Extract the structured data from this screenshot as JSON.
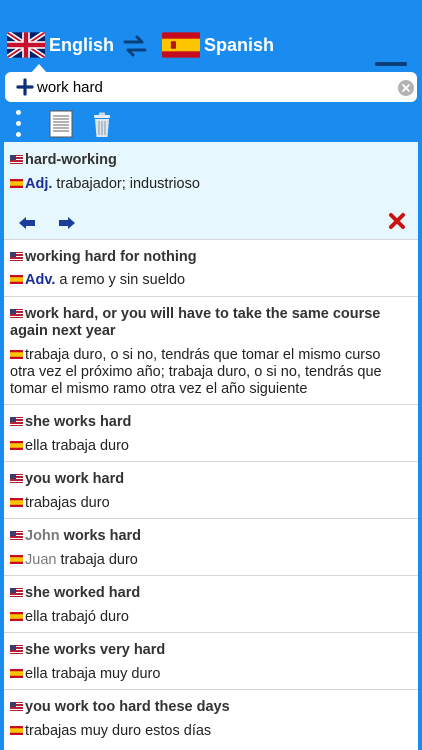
{
  "header": {
    "source_language": "English",
    "target_language": "Spanish",
    "swap_icon": "swap-arrows-icon",
    "menu_icon": "hamburger-menu-icon"
  },
  "search": {
    "value": "work hard",
    "add_icon": "plus-icon",
    "clear_icon": "clear-circle-icon"
  },
  "toolbar": {
    "more_icon": "vertical-dots-icon",
    "document_icon": "document-icon",
    "trash_icon": "trash-icon"
  },
  "results": [
    {
      "en": [
        {
          "t": "hard-working",
          "c": "b"
        }
      ],
      "es": [
        {
          "t": "Adj. ",
          "c": "pos"
        },
        {
          "t": "trabajador; industrioso",
          "c": ""
        }
      ],
      "selected": true
    },
    {
      "en": [
        {
          "t": "working hard for nothing",
          "c": "b"
        }
      ],
      "es": [
        {
          "t": "Adv. ",
          "c": "pos"
        },
        {
          "t": "a remo y sin sueldo",
          "c": ""
        }
      ]
    },
    {
      "en": [
        {
          "t": "work hard, or you will have to take the same course again next year",
          "c": "b"
        }
      ],
      "es": [
        {
          "t": "trabaja duro, o si no, tendrás que tomar el mismo curso otra vez el próximo año; trabaja duro, o si no, tendrás que tomar el mismo ramo otra vez el año siguiente",
          "c": ""
        }
      ]
    },
    {
      "en": [
        {
          "t": "she works hard",
          "c": "b"
        }
      ],
      "es": [
        {
          "t": "ella trabaja duro",
          "c": ""
        }
      ]
    },
    {
      "en": [
        {
          "t": "you work hard",
          "c": "b"
        }
      ],
      "es": [
        {
          "t": "trabajas duro",
          "c": ""
        }
      ]
    },
    {
      "en": [
        {
          "t": "John ",
          "c": "gray"
        },
        {
          "t": "works hard",
          "c": "b"
        }
      ],
      "es": [
        {
          "t": "Juan ",
          "c": "gray"
        },
        {
          "t": "trabaja duro",
          "c": ""
        }
      ]
    },
    {
      "en": [
        {
          "t": "she worked hard",
          "c": "b"
        }
      ],
      "es": [
        {
          "t": "ella trabajó duro",
          "c": ""
        }
      ]
    },
    {
      "en": [
        {
          "t": "she works very hard",
          "c": "b"
        }
      ],
      "es": [
        {
          "t": "ella trabaja muy duro",
          "c": ""
        }
      ]
    },
    {
      "en": [
        {
          "t": "you work too hard these days",
          "c": "b"
        }
      ],
      "es": [
        {
          "t": "trabajas muy duro estos días",
          "c": ""
        }
      ]
    }
  ],
  "entry_actions": {
    "prev_icon": "arrow-left-icon",
    "next_icon": "arrow-right-icon",
    "delete_icon": "red-x-icon"
  },
  "colors": {
    "accent": "#1a8cf0",
    "selected_row": "#e6f7fd",
    "part_of_speech": "#1a2f99",
    "delete": "#cc1111"
  }
}
